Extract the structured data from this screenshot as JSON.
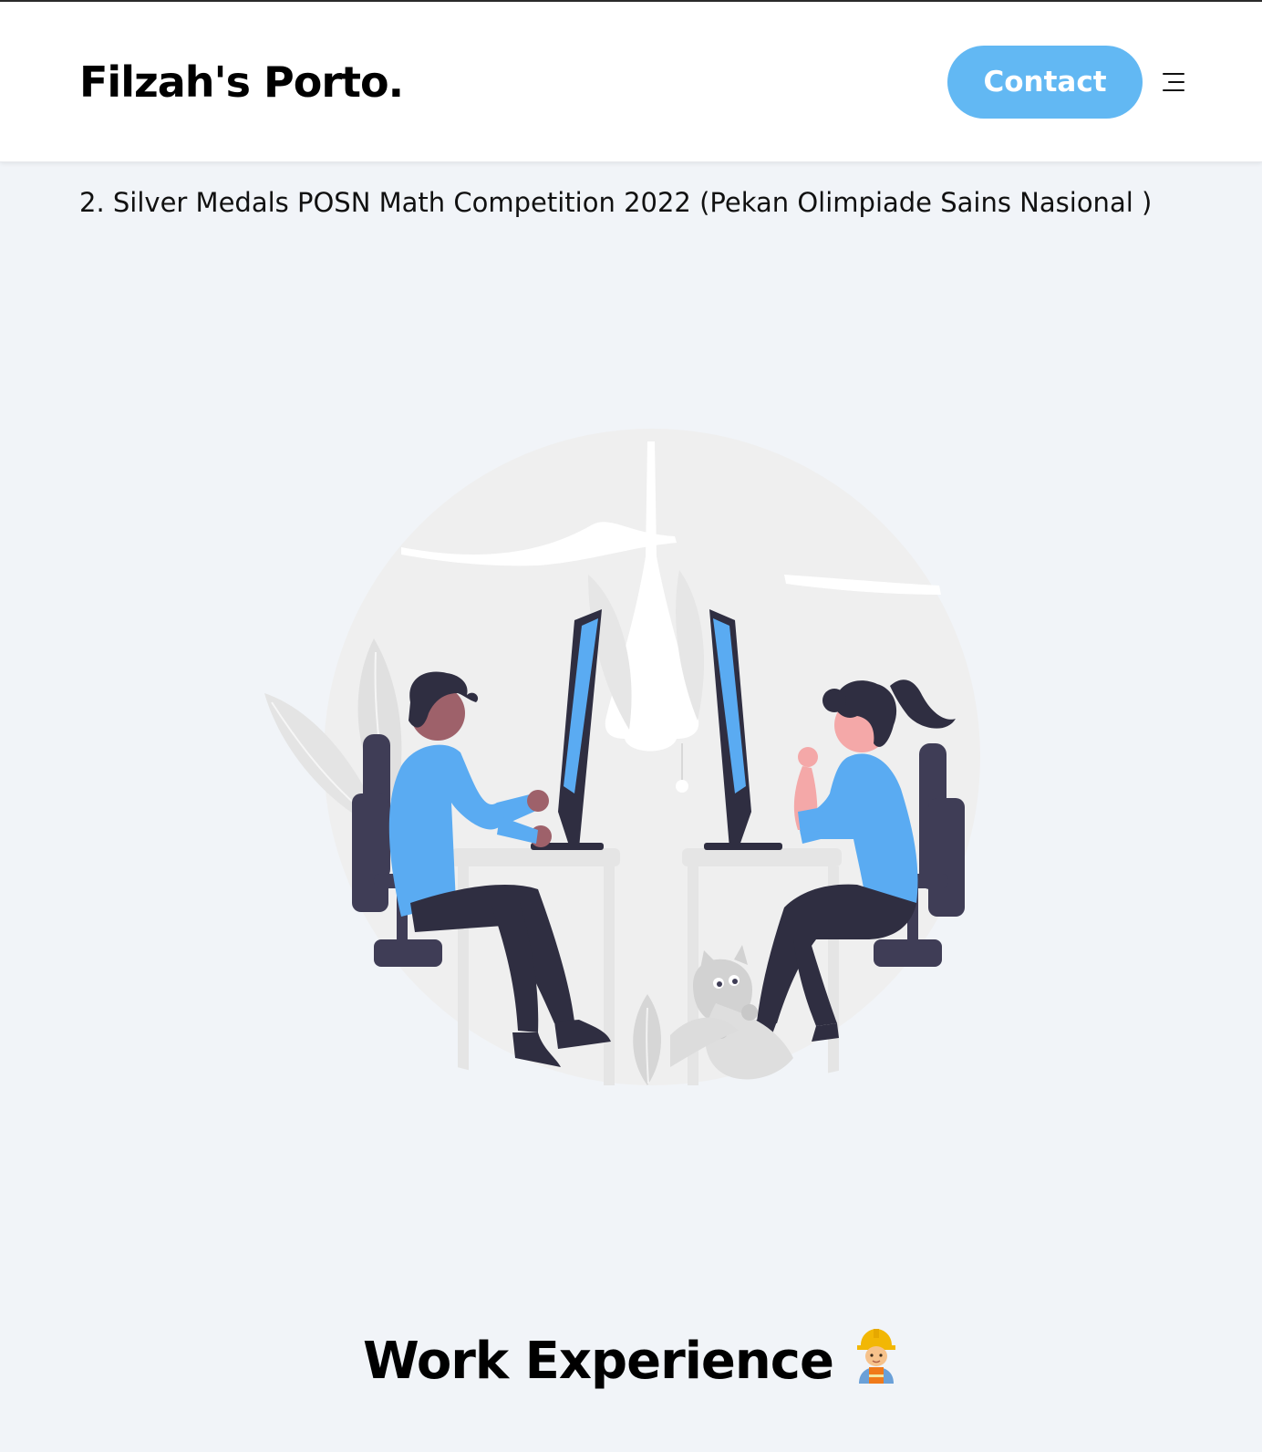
{
  "header": {
    "brand": "Filzah's Porto.",
    "contact_label": "Contact",
    "menu_icon": "menu-icon"
  },
  "awards": {
    "item_2": "2. Silver Medals POSN Math Competition 2022 (Pekan Olimpiade Sains Nasional )"
  },
  "illustration": {
    "icon": "two-people-at-computers-illustration"
  },
  "work_experience": {
    "title": "Work Experience",
    "emoji_icon": "construction-worker-icon"
  },
  "colors": {
    "accent": "#62b8f3",
    "page_background": "#f1f4f8",
    "header_background": "#ffffff",
    "figure_blue": "#5aabf2",
    "figure_dark": "#2f2e41"
  }
}
